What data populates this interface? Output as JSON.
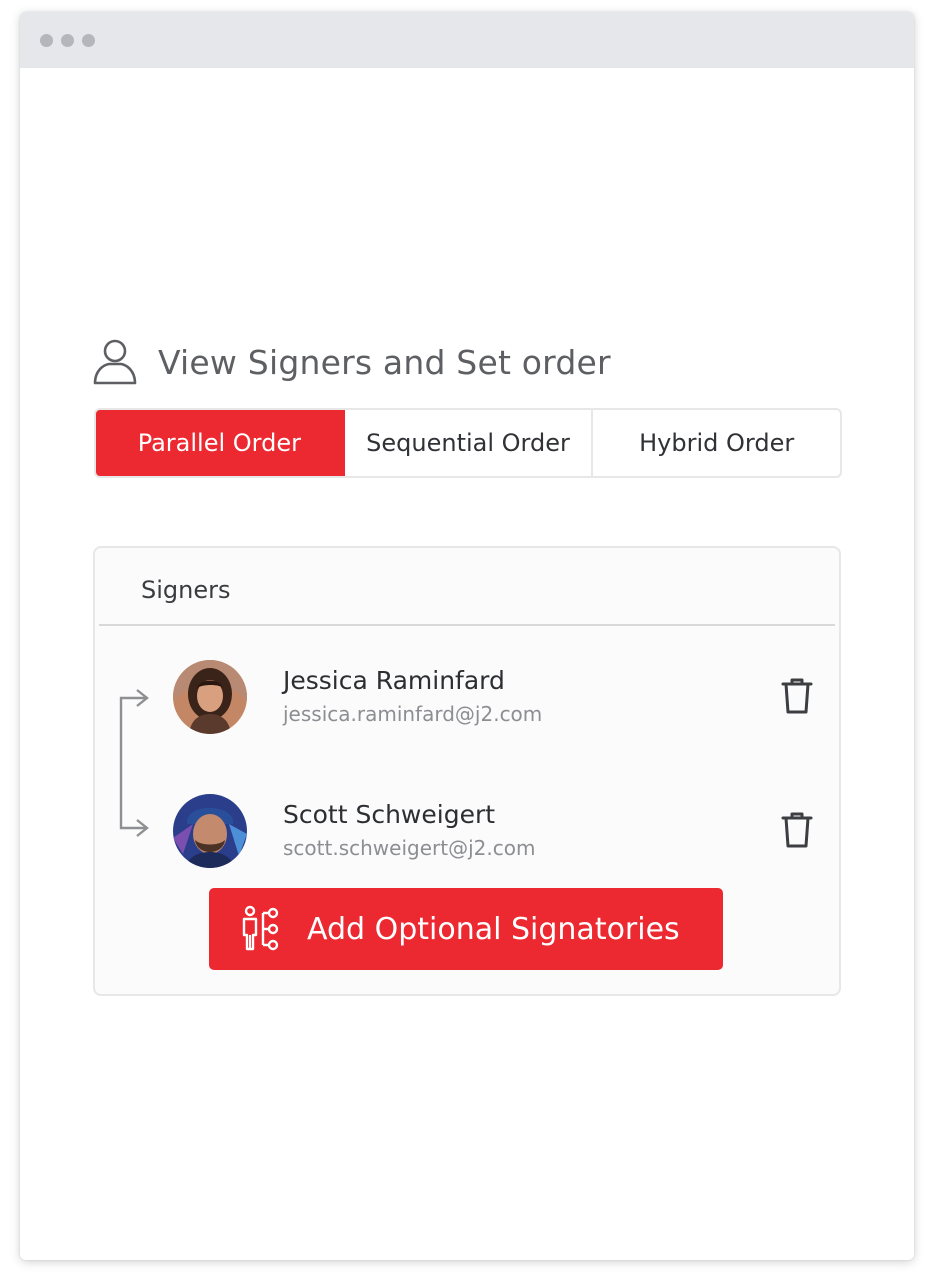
{
  "window": {
    "controls": [
      "dot",
      "dot",
      "dot"
    ]
  },
  "heading": {
    "title": "View Signers and Set order",
    "icon": "user-icon"
  },
  "order_tabs": [
    {
      "label": "Parallel Order",
      "active": true
    },
    {
      "label": "Sequential Order",
      "active": false
    },
    {
      "label": "Hybrid Order",
      "active": false
    }
  ],
  "signers_panel": {
    "title": "Signers",
    "signers": [
      {
        "name": "Jessica Raminfard",
        "email": "jessica.raminfard@j2.com",
        "avatar": "avatar-photo"
      },
      {
        "name": "Scott Schweigert",
        "email": "scott.schweigert@j2.com",
        "avatar": "avatar-photo"
      }
    ],
    "delete_icon": "trash-icon",
    "add_button": {
      "label": "Add Optional Signatories",
      "icon": "org-chart-icon"
    }
  },
  "colors": {
    "accent": "#ec2830",
    "titlebar": "#e6e7ea",
    "heading_text": "#5d5f63",
    "border": "#e7e7e7"
  }
}
